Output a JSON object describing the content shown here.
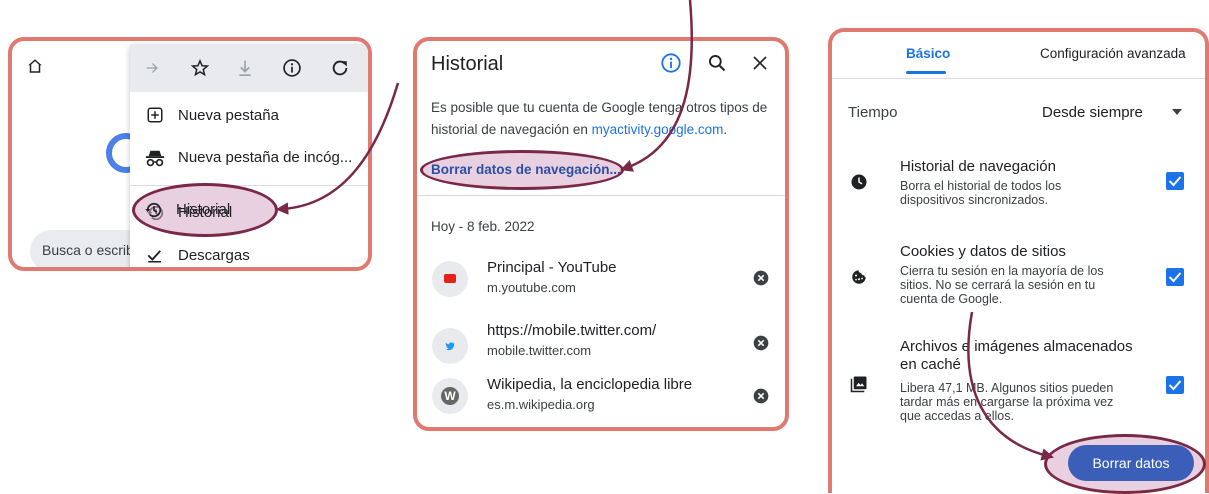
{
  "panel1": {
    "search_placeholder": "Busca o escrib",
    "menu": {
      "items": [
        {
          "label": "Nueva pestaña",
          "icon": "new-tab-icon"
        },
        {
          "label": "Nueva pestaña de incóg...",
          "icon": "incognito-icon"
        },
        {
          "label": "Historial",
          "icon": "history-icon"
        },
        {
          "label": "Descargas",
          "icon": "downloads-icon"
        }
      ]
    }
  },
  "panel2": {
    "title": "Historial",
    "info_text_1": "Es posible que tu cuenta de Google tenga otros tipos de",
    "info_text_2": "historial de navegación en",
    "info_link": "myactivity.google.com",
    "clear_link": "Borrar datos de navegación...",
    "date_header": "Hoy - 8 feb. 2022",
    "entries": [
      {
        "title": "Principal - YouTube",
        "url": "m.youtube.com"
      },
      {
        "title": "https://mobile.twitter.com/",
        "url": "mobile.twitter.com"
      },
      {
        "title": "Wikipedia, la enciclopedia libre",
        "url": "es.m.wikipedia.org",
        "favicon_letter": "W"
      }
    ]
  },
  "panel3": {
    "tabs": {
      "basic": "Básico",
      "advanced": "Configuración avanzada"
    },
    "time_label": "Tiempo",
    "time_value": "Desde siempre",
    "options": [
      {
        "title": "Historial de navegación",
        "desc_1": "Borra el historial de todos los",
        "desc_2": "dispositivos sincronizados.",
        "checked": true
      },
      {
        "title": "Cookies y datos de sitios",
        "desc_1": "Cierra tu sesión en la mayoría de los",
        "desc_2": "sitios. No se cerrará la sesión en tu",
        "desc_3": "cuenta de Google.",
        "checked": true
      },
      {
        "title_1": "Archivos e imágenes almacenados",
        "title_2": "en caché",
        "desc_1": "Libera 47,1 MB. Algunos sitios pueden",
        "desc_2": "tardar más en cargarse la próxima vez",
        "desc_3": "que accedas a ellos.",
        "checked": true
      }
    ],
    "clear_button": "Borrar datos"
  },
  "colors": {
    "frame": "#e07a70",
    "highlight": "#d7aac8",
    "arrow": "#7a2848",
    "accent": "#1a73e8",
    "button": "#3b5fb8"
  }
}
